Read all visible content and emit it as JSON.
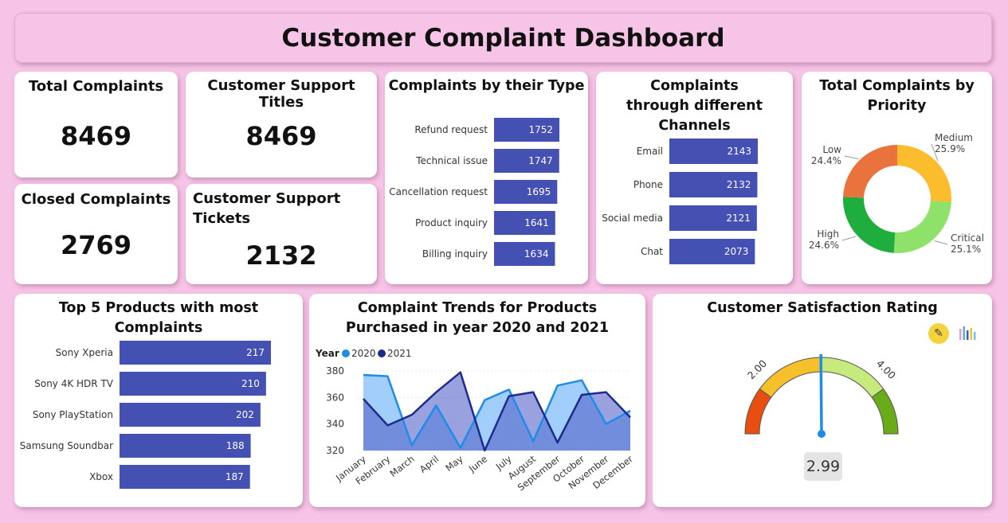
{
  "header": {
    "title": "Customer Complaint Dashboard"
  },
  "kpis": {
    "total_complaints": {
      "label": "Total Complaints",
      "value": "8469"
    },
    "support_titles": {
      "label": "Customer Support Titles",
      "value": "8469"
    },
    "closed_complaints": {
      "label": "Closed Complaints",
      "value": "2769"
    },
    "support_tickets": {
      "label": "Customer Support Tickets",
      "value": "2132"
    }
  },
  "colors": {
    "bar": "#4550b3",
    "area_2020": "#9ccbfb",
    "line_2020": "#1e8ce8",
    "line_2021": "#1d2b8c",
    "area_2021": "#5562c9"
  },
  "gauge": {
    "title": "Customer Satisfaction Rating",
    "value": "2.99",
    "min": 1,
    "max": 5,
    "needle": 2.99,
    "tick_labels": [
      "2.00",
      "4.00"
    ],
    "icons": [
      "pencil-icon",
      "column-chart-icon"
    ]
  },
  "chart_data": [
    {
      "type": "bar",
      "title": "Complaints by their Type",
      "categories": [
        "Refund request",
        "Technical issue",
        "Cancellation request",
        "Product inquiry",
        "Billing inquiry"
      ],
      "values": [
        1752,
        1747,
        1695,
        1641,
        1634
      ],
      "labels": [
        "1752",
        "1747",
        "1695",
        "1641",
        "1634"
      ]
    },
    {
      "type": "bar",
      "title": "Complaints through different Channels",
      "categories": [
        "Email",
        "Phone",
        "Social media",
        "Chat"
      ],
      "values": [
        2143,
        2132,
        2121,
        2073
      ],
      "labels": [
        "2143",
        "2132",
        "2121",
        "2073"
      ]
    },
    {
      "type": "pie",
      "title": "Total Complaints by Priority",
      "slices": [
        {
          "name": "Medium",
          "value": 25.9,
          "label": "25.9%",
          "color": "#fbbd2d"
        },
        {
          "name": "Critical",
          "value": 25.1,
          "label": "25.1%",
          "color": "#8fe269"
        },
        {
          "name": "High",
          "value": 24.6,
          "label": "24.6%",
          "color": "#1fae3e"
        },
        {
          "name": "Low",
          "value": 24.4,
          "label": "24.4%",
          "color": "#e9723d"
        }
      ]
    },
    {
      "type": "bar",
      "title": "Top 5 Products with most Complaints",
      "categories": [
        "Sony Xperia",
        "Sony 4K HDR TV",
        "Sony PlayStation",
        "Samsung Soundbar",
        "Xbox"
      ],
      "values": [
        217,
        210,
        202,
        188,
        187
      ],
      "labels": [
        "217",
        "210",
        "202",
        "188",
        "187"
      ]
    },
    {
      "type": "area",
      "title": "Complaint Trends for Products Purchased in year 2020 and 2021",
      "legend_title": "Year",
      "x": [
        "January",
        "February",
        "March",
        "April",
        "May",
        "June",
        "July",
        "August",
        "September",
        "October",
        "November",
        "December"
      ],
      "ylim": [
        320,
        380
      ],
      "yticks": [
        "380",
        "360",
        "340",
        "320"
      ],
      "series": [
        {
          "name": "2020",
          "values": [
            377,
            376,
            324,
            354,
            322,
            358,
            366,
            327,
            369,
            373,
            340,
            350
          ]
        },
        {
          "name": "2021",
          "values": [
            359,
            339,
            347,
            364,
            379,
            320,
            361,
            364,
            326,
            362,
            364,
            345
          ]
        }
      ]
    }
  ]
}
